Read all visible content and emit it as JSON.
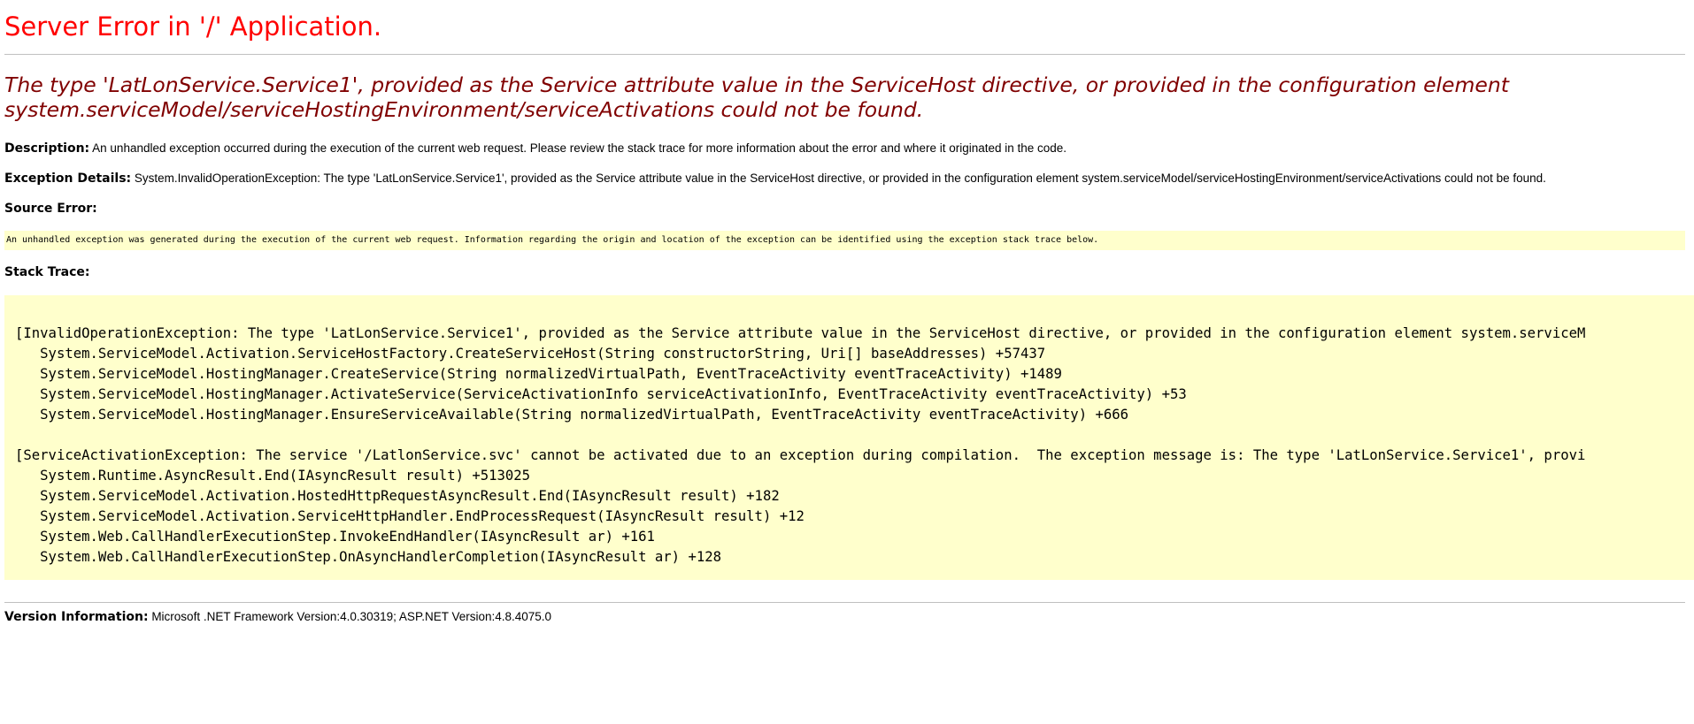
{
  "error_title": "Server Error in '/' Application.",
  "error_message": "The type 'LatLonService.Service1', provided as the Service attribute value in the ServiceHost directive, or provided in the configuration element system.serviceModel/serviceHostingEnvironment/serviceActivations could not be found.",
  "description": {
    "label": "Description:",
    "text": " An unhandled exception occurred during the execution of the current web request. Please review the stack trace for more information about the error and where it originated in the code."
  },
  "exception_details": {
    "label": "Exception Details:",
    "text": " System.InvalidOperationException: The type 'LatLonService.Service1', provided as the Service attribute value in the ServiceHost directive, or provided in the configuration element system.serviceModel/serviceHostingEnvironment/serviceActivations could not be found."
  },
  "source_error": {
    "label": "Source Error:",
    "text": "An unhandled exception was generated during the execution of the current web request. Information regarding the origin and location of the exception can be identified using the exception stack trace below."
  },
  "stack_trace": {
    "label": "Stack Trace:",
    "lines": [
      "[InvalidOperationException: The type 'LatLonService.Service1', provided as the Service attribute value in the ServiceHost directive, or provided in the configuration element system.serviceM",
      "   System.ServiceModel.Activation.ServiceHostFactory.CreateServiceHost(String constructorString, Uri[] baseAddresses) +57437",
      "   System.ServiceModel.HostingManager.CreateService(String normalizedVirtualPath, EventTraceActivity eventTraceActivity) +1489",
      "   System.ServiceModel.HostingManager.ActivateService(ServiceActivationInfo serviceActivationInfo, EventTraceActivity eventTraceActivity) +53",
      "   System.ServiceModel.HostingManager.EnsureServiceAvailable(String normalizedVirtualPath, EventTraceActivity eventTraceActivity) +666",
      "",
      "[ServiceActivationException: The service '/LatlonService.svc' cannot be activated due to an exception during compilation.  The exception message is: The type 'LatLonService.Service1', provi",
      "   System.Runtime.AsyncResult.End(IAsyncResult result) +513025",
      "   System.ServiceModel.Activation.HostedHttpRequestAsyncResult.End(IAsyncResult result) +182",
      "   System.ServiceModel.Activation.ServiceHttpHandler.EndProcessRequest(IAsyncResult result) +12",
      "   System.Web.CallHandlerExecutionStep.InvokeEndHandler(IAsyncResult ar) +161",
      "   System.Web.CallHandlerExecutionStep.OnAsyncHandlerCompletion(IAsyncResult ar) +128"
    ]
  },
  "version_info": {
    "label": "Version Information:",
    "text": " Microsoft .NET Framework Version:4.0.30319; ASP.NET Version:4.8.4075.0"
  }
}
